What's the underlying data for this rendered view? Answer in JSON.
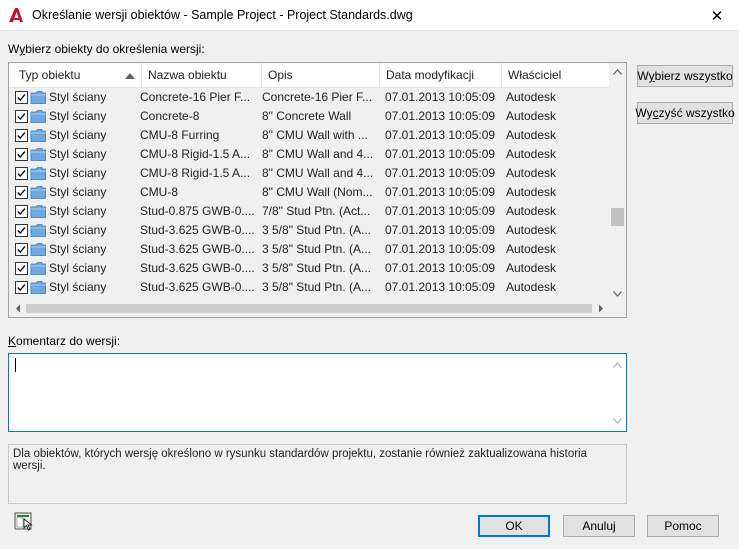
{
  "window": {
    "title": "Określanie wersji obiektów - Sample Project - Project Standards.dwg",
    "close_glyph": "✕"
  },
  "select_label": {
    "pre": "W",
    "key": "y",
    "post": "bierz obiekty do określenia wersji:"
  },
  "table": {
    "columns": [
      "Typ obiektu",
      "Nazwa obiektu",
      "Opis",
      "Data modyfikacji",
      "Właściciel"
    ],
    "sort": {
      "column": "Typ obiektu",
      "direction": "ascending"
    },
    "rows": [
      {
        "checked": true,
        "type": "Styl ściany",
        "name": "Concrete-16 Pier F...",
        "desc": "Concrete-16 Pier F...",
        "date": "07.01.2013 10:05:09",
        "owner": "Autodesk"
      },
      {
        "checked": true,
        "type": "Styl ściany",
        "name": "Concrete-8",
        "desc": "8\" Concrete Wall",
        "date": "07.01.2013 10:05:09",
        "owner": "Autodesk"
      },
      {
        "checked": true,
        "type": "Styl ściany",
        "name": "CMU-8 Furring",
        "desc": "8\" CMU Wall with ...",
        "date": "07.01.2013 10:05:09",
        "owner": "Autodesk"
      },
      {
        "checked": true,
        "type": "Styl ściany",
        "name": "CMU-8 Rigid-1.5 A...",
        "desc": "8\" CMU Wall and 4...",
        "date": "07.01.2013 10:05:09",
        "owner": "Autodesk"
      },
      {
        "checked": true,
        "type": "Styl ściany",
        "name": "CMU-8 Rigid-1.5 A...",
        "desc": "8\" CMU Wall and 4...",
        "date": "07.01.2013 10:05:09",
        "owner": "Autodesk"
      },
      {
        "checked": true,
        "type": "Styl ściany",
        "name": "CMU-8",
        "desc": "8\" CMU Wall (Nom...",
        "date": "07.01.2013 10:05:09",
        "owner": "Autodesk"
      },
      {
        "checked": true,
        "type": "Styl ściany",
        "name": "Stud-0.875 GWB-0....",
        "desc": "7/8\" Stud Ptn. (Act...",
        "date": "07.01.2013 10:05:09",
        "owner": "Autodesk"
      },
      {
        "checked": true,
        "type": "Styl ściany",
        "name": "Stud-3.625 GWB-0....",
        "desc": "3 5/8\" Stud Ptn. (A...",
        "date": "07.01.2013 10:05:09",
        "owner": "Autodesk"
      },
      {
        "checked": true,
        "type": "Styl ściany",
        "name": "Stud-3.625 GWB-0....",
        "desc": "3 5/8\" Stud Ptn. (A...",
        "date": "07.01.2013 10:05:09",
        "owner": "Autodesk"
      },
      {
        "checked": true,
        "type": "Styl ściany",
        "name": "Stud-3.625 GWB-0....",
        "desc": "3 5/8\" Stud Ptn. (A...",
        "date": "07.01.2013 10:05:09",
        "owner": "Autodesk"
      },
      {
        "checked": true,
        "type": "Styl ściany",
        "name": "Stud-3.625 GWB-0....",
        "desc": "3 5/8\" Stud Ptn. (A...",
        "date": "07.01.2013 10:05:09",
        "owner": "Autodesk"
      }
    ]
  },
  "buttons": {
    "select_all": {
      "pre": "W",
      "key": "y",
      "post": "bierz wszystko"
    },
    "clear_all": {
      "pre": "Wy",
      "key": "c",
      "post": "zyść wszystko"
    },
    "ok": "OK",
    "cancel": "Anuluj",
    "help": "Pomoc"
  },
  "comment": {
    "label_key": "K",
    "label_post": "omentarz do wersji:",
    "value": ""
  },
  "info_text": "Dla obiektów, których wersję określono w rysunku standardów projektu, zostanie również zaktualizowana historia wersji.",
  "colors": {
    "accent": "#0078d7",
    "app_icon": "#c8102e",
    "folder": "#6fa8dc"
  },
  "icons": {
    "app": "autocad-logo-icon",
    "row": "folder-icon",
    "helper": "dialog-helper-icon"
  }
}
